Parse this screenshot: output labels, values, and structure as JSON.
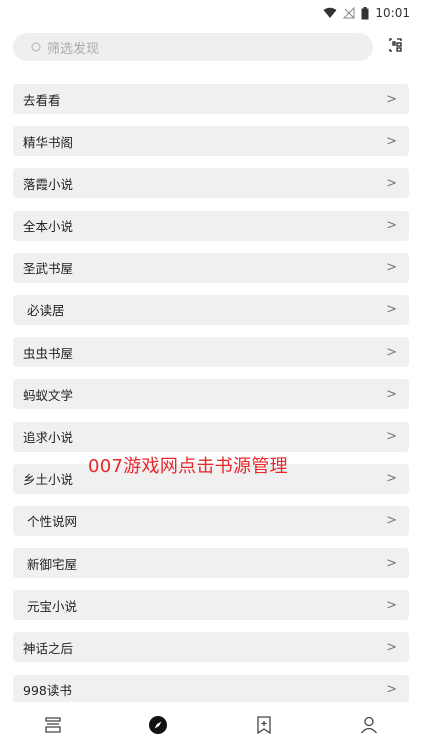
{
  "status_bar": {
    "time": "10:01",
    "icons": [
      "wifi-icon",
      "signal-icon",
      "battery-icon"
    ]
  },
  "search": {
    "placeholder": "筛选发现",
    "icon": "search-icon"
  },
  "scan_icon": "scan-icon",
  "sources": [
    {
      "label": "去看看"
    },
    {
      "label": "精华书阁"
    },
    {
      "label": "落霞小说"
    },
    {
      "label": "全本小说"
    },
    {
      "label": "圣武书屋"
    },
    {
      "label": " 必读居"
    },
    {
      "label": "虫虫书屋"
    },
    {
      "label": "蚂蚁文学"
    },
    {
      "label": "追求小说"
    },
    {
      "label": "乡土小说"
    },
    {
      "label": " 个性说网"
    },
    {
      "label": " 新御宅屋"
    },
    {
      "label": " 元宝小说"
    },
    {
      "label": "神话之后"
    },
    {
      "label": "998读书"
    }
  ],
  "chevron": ">",
  "overlay": "007游戏网点击书源管理",
  "bottom_nav": [
    "bookshelf-icon",
    "explore-icon",
    "rss-icon",
    "profile-icon"
  ]
}
